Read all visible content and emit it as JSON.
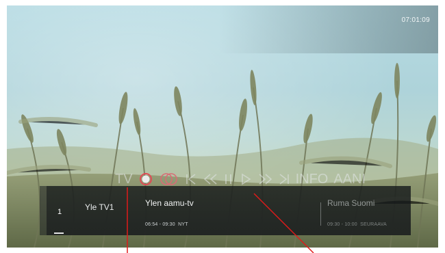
{
  "status": {
    "clock": "07:01:09"
  },
  "controls": {
    "tv_label": "TV",
    "info_label": "INFO",
    "aani_label": "AANI",
    "record_color": "#e8e8e8",
    "record_ring_color": "#e04a55",
    "dual_record_color": "#d86b75",
    "icons": [
      "tv-label",
      "record-icon",
      "dual-record-icon",
      "skip-back-icon",
      "rewind-icon",
      "pause-icon",
      "play-icon",
      "fast-forward-icon",
      "skip-forward-icon",
      "info-label",
      "audio-label"
    ]
  },
  "channel": {
    "number": "1",
    "name": "Yle TV1"
  },
  "now": {
    "title": "Ylen aamu-tv",
    "time": "06:54 - 09:30",
    "tag": "NYT"
  },
  "next": {
    "title": "Ruma Suomi",
    "time": "09:30 - 10:00",
    "tag": "SEURAAVA"
  },
  "annotation_color": "#e01a1a"
}
